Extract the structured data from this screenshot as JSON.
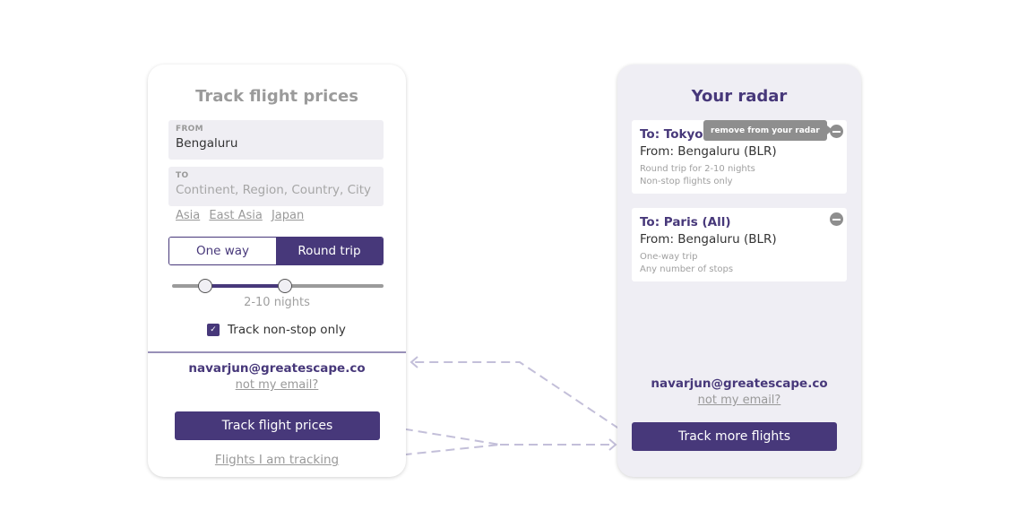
{
  "left_panel": {
    "title": "Track flight prices",
    "from": {
      "label": "FROM",
      "value": "Bengaluru"
    },
    "to": {
      "label": "TO",
      "placeholder": "Continent, Region, Country, City"
    },
    "suggestions": [
      "Asia",
      "East Asia",
      "Japan"
    ],
    "trip_type": {
      "options": [
        "One way",
        "Round trip"
      ],
      "selected": "Round trip"
    },
    "nights_slider": {
      "min_value": 2,
      "max_value": 10,
      "label": "2-10 nights"
    },
    "nonstop_checkbox": {
      "label": "Track non-stop only",
      "checked": true
    },
    "email": "navarjun@greatescape.co",
    "not_my_email": "not my email?",
    "primary_button": "Track flight prices",
    "tracking_link": "Flights I am tracking"
  },
  "right_panel": {
    "title": "Your radar",
    "cards": [
      {
        "to": "To: Tokyo (All)",
        "from": "From: Bengaluru (BLR)",
        "details": [
          "Round trip for 2-10 nights",
          "Non-stop flights only"
        ],
        "tooltip": "remove from your radar"
      },
      {
        "to": "To: Paris (All)",
        "from": "From: Bengaluru (BLR)",
        "details": [
          "One-way trip",
          "Any number of stops"
        ]
      }
    ],
    "email": "navarjun@greatescape.co",
    "not_my_email": "not my email?",
    "primary_button": "Track more flights"
  },
  "colors": {
    "brand": "#47387a",
    "connector": "#c3bfd9",
    "muted": "#999999"
  }
}
